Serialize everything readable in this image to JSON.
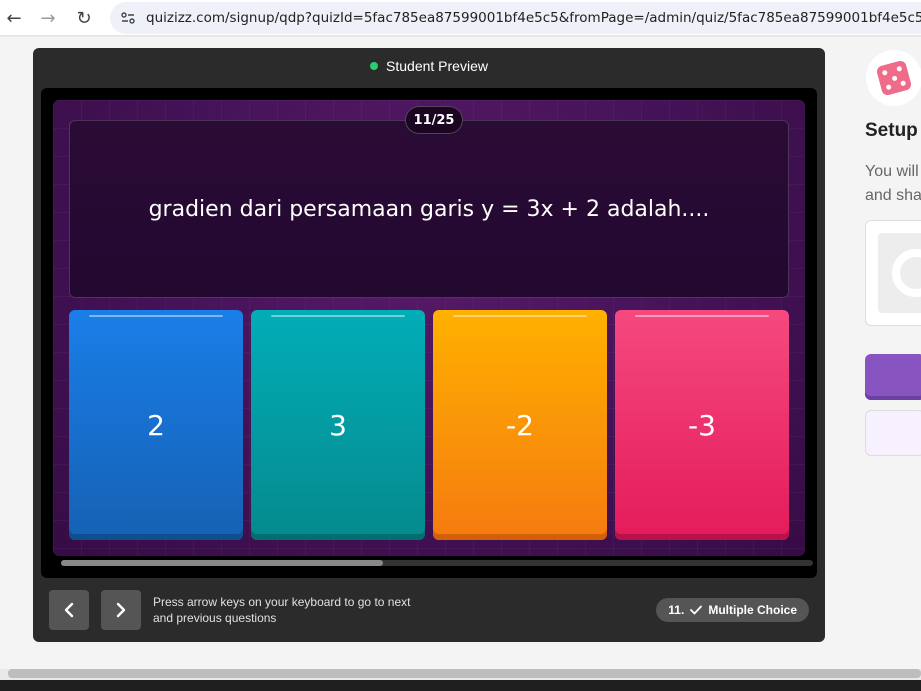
{
  "browser": {
    "url": "quizizz.com/signup/qdp?quizId=5fac785ea87599001bf4e5c5&fromPage=/admin/quiz/5fac785ea87599001bf4e5c5/latihan-gr",
    "icons": {
      "back": "arrow-left-icon",
      "forward": "arrow-right-icon",
      "reload": "reload-icon",
      "site_info": "site-settings-icon"
    }
  },
  "modal": {
    "title": "Student Preview",
    "status_color": "#2ecc71"
  },
  "question": {
    "counter": "11/25",
    "text": "gradien dari persamaan garis y = 3x + 2 adalah...."
  },
  "options": [
    {
      "label": "2",
      "color": "#1a7ee8"
    },
    {
      "label": "3",
      "color": "#02adb8"
    },
    {
      "label": "-2",
      "color": "#ffb100"
    },
    {
      "label": "-3",
      "color": "#f5497f"
    }
  ],
  "footer": {
    "prev_icon": "chevron-left-icon",
    "next_icon": "chevron-right-icon",
    "hint_line1": "Press arrow keys on your keyboard to go to next",
    "hint_line2": "and previous questions",
    "question_number": "11.",
    "check_icon": "check-icon",
    "question_type": "Multiple Choice"
  },
  "side_panel": {
    "title": "Setup",
    "desc_line1": "You will",
    "desc_line2": "and sha",
    "dice_icon": "dice-icon",
    "accent_color": "#8854c0"
  }
}
